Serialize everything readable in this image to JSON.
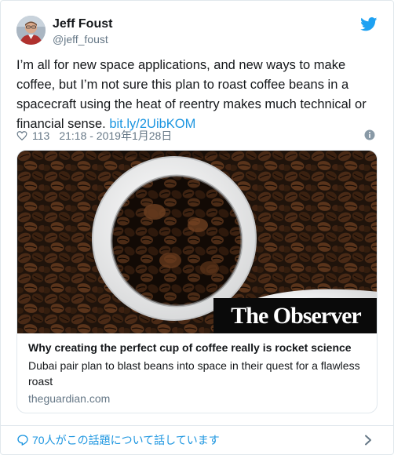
{
  "author": {
    "name": "Jeff Foust",
    "handle": "@jeff_foust"
  },
  "icons": {
    "brand": "twitter-bird-icon",
    "like": "heart-icon",
    "info": "info-icon",
    "conversation": "speech-bubble-icon",
    "more": "chevron-right-icon"
  },
  "tweet": {
    "text": "I’m all for new space applications, and new ways to make coffee, but I’m not sure this plan to roast coffee beans in a spacecraft using the heat of reentry makes much technical or financial sense.",
    "link": "bit.ly/2UibKOM",
    "likes": "113",
    "timestamp": "21:18 - 2019年1月28日"
  },
  "card": {
    "logo_text": "The Observer",
    "title": "Why creating the perfect cup of coffee really is rocket science",
    "description": "Dubai pair plan to blast beans into space in their quest for a flawless roast",
    "domain": "theguardian.com"
  },
  "footer": {
    "conversation_label": "70人がこの話題について話しています"
  },
  "colors": {
    "accent": "#1b95e0",
    "text": "#14171a",
    "muted": "#657786",
    "border": "#e1e8ed"
  }
}
